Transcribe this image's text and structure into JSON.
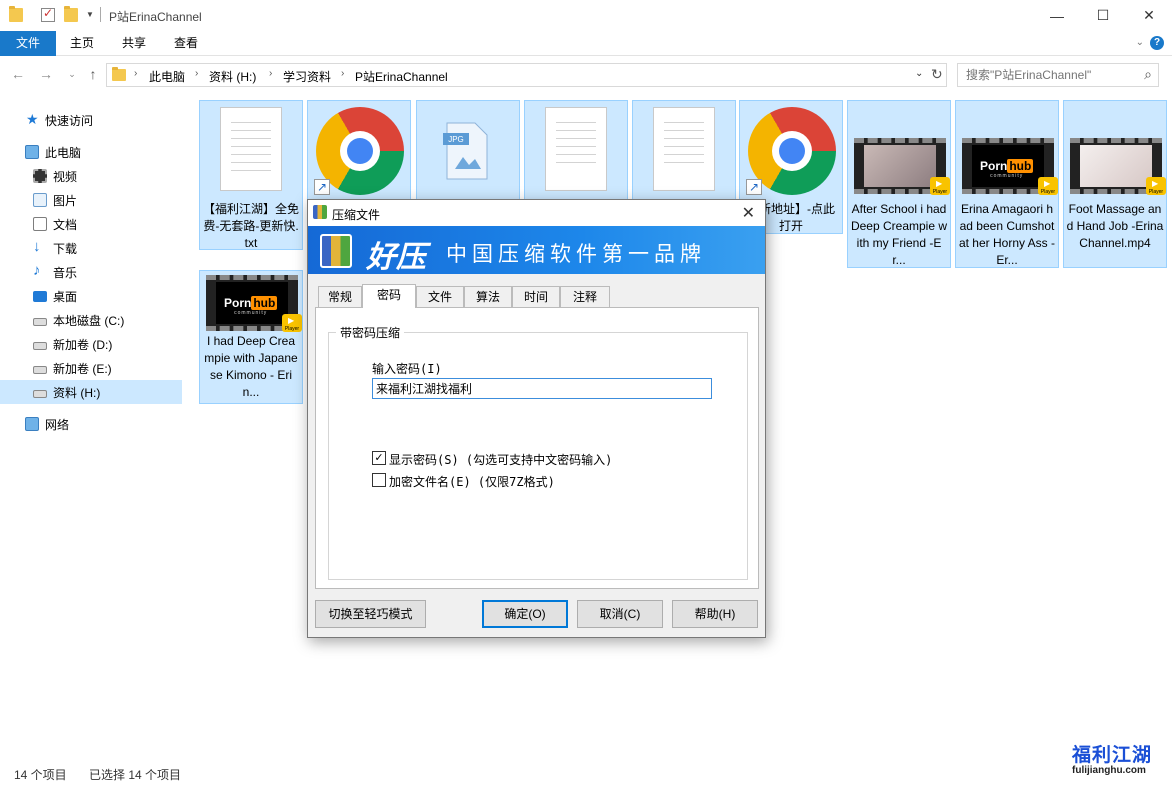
{
  "window": {
    "title": "P站ErinaChannel",
    "minimize": "—",
    "maximize": "☐",
    "close": "✕"
  },
  "ribbon": {
    "tabs": [
      "文件",
      "主页",
      "共享",
      "查看"
    ],
    "expand_icon": "chevron-down-icon",
    "help_label": "?"
  },
  "address": {
    "crumbs": [
      "此电脑",
      "资料 (H:)",
      "学习资料",
      "P站ErinaChannel"
    ],
    "search_placeholder": "搜索\"P站ErinaChannel\""
  },
  "sidebar": {
    "items": [
      {
        "label": "快速访问",
        "icon": "star-icon"
      },
      {
        "label": "此电脑",
        "icon": "computer-icon"
      },
      {
        "label": "视频",
        "icon": "video-folder-icon"
      },
      {
        "label": "图片",
        "icon": "pictures-folder-icon"
      },
      {
        "label": "文档",
        "icon": "documents-folder-icon"
      },
      {
        "label": "下载",
        "icon": "download-icon"
      },
      {
        "label": "音乐",
        "icon": "music-icon"
      },
      {
        "label": "桌面",
        "icon": "desktop-icon"
      },
      {
        "label": "本地磁盘 (C:)",
        "icon": "drive-icon"
      },
      {
        "label": "新加卷 (D:)",
        "icon": "drive-icon"
      },
      {
        "label": "新加卷 (E:)",
        "icon": "drive-icon"
      },
      {
        "label": "资料 (H:)",
        "icon": "drive-icon"
      },
      {
        "label": "网络",
        "icon": "network-icon"
      }
    ]
  },
  "files": [
    {
      "name": "【福利江湖】全免费-无套路-更新快.txt",
      "type": "text"
    },
    {
      "name": "",
      "type": "chrome-shortcut"
    },
    {
      "name": "",
      "type": "jpg"
    },
    {
      "name": "",
      "type": "text"
    },
    {
      "name": "",
      "type": "text"
    },
    {
      "name": "最新地址】-点此打开",
      "type": "chrome-shortcut"
    },
    {
      "name": "After School i had Deep Creampie with my Friend -Er...",
      "type": "video"
    },
    {
      "name": "Erina Amagaori had been Cumshot at her Horny Ass -Er...",
      "type": "video"
    },
    {
      "name": "Foot Massage and Hand Job -ErinaChannel.mp4",
      "type": "video"
    },
    {
      "name": "I had Deep Creampie with Japanese Kimono - Erin...",
      "type": "video"
    }
  ],
  "pornhub_logo": {
    "porn": "Porn",
    "hub": "hub",
    "community": "community"
  },
  "player_badge": "Player",
  "jpg_label": "JPG",
  "status": {
    "count": "14 个项目",
    "selected": "已选择 14 个项目"
  },
  "watermark": {
    "cn": "福利江湖",
    "en": "fulijianghu.com"
  },
  "dialog": {
    "title": "压缩文件",
    "brand": "好压",
    "slogan": "中国压缩软件第一品牌",
    "tabs": [
      "常规",
      "密码",
      "文件",
      "算法",
      "时间",
      "注释"
    ],
    "active_tab": "密码",
    "group_title": "带密码压缩",
    "password_label": "输入密码(I)",
    "password_value": "来福利江湖找福利",
    "show_password": {
      "label": "显示密码(S)  (勾选可支持中文密码输入)",
      "checked": true
    },
    "encrypt_names": {
      "label": "加密文件名(E)  (仅限7Z格式)",
      "checked": false
    },
    "buttons": {
      "switch_mode": "切换至轻巧模式",
      "ok": "确定(O)",
      "cancel": "取消(C)",
      "help": "帮助(H)"
    }
  }
}
